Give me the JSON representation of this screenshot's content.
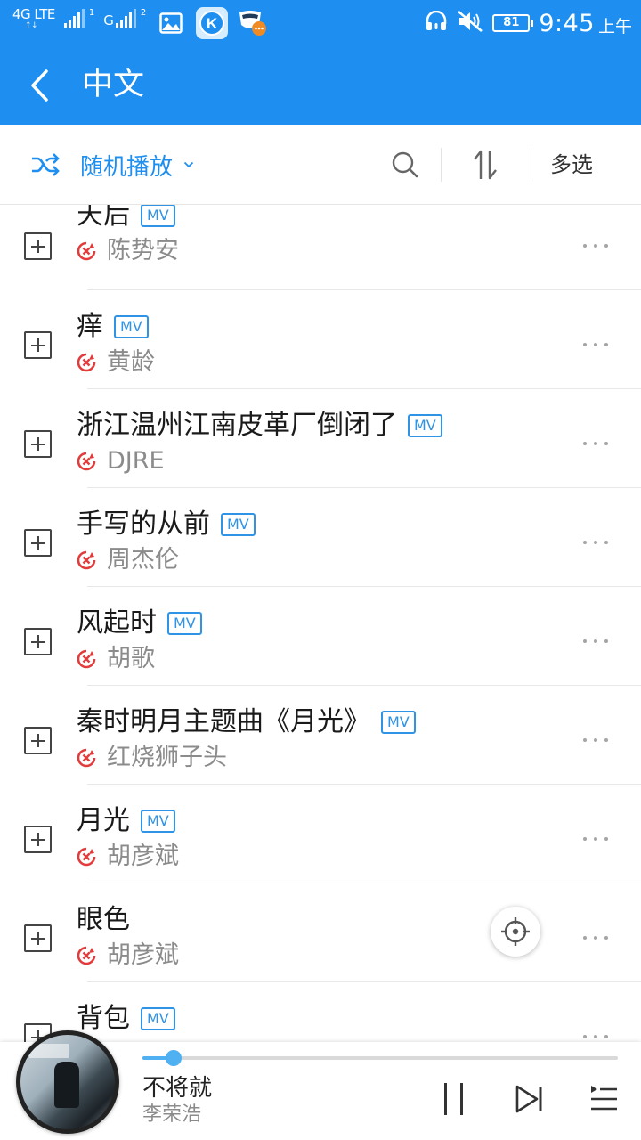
{
  "status_bar": {
    "network": "4G LTE",
    "network_sub": "↑↓",
    "sim1_index": "1",
    "sim2_label": "G",
    "sim2_index": "2",
    "battery": "81",
    "time": "9:45",
    "ampm": "上午",
    "icons": [
      "image-icon",
      "kugou-app-icon",
      "message-app-icon",
      "headset-icon",
      "mute-icon"
    ]
  },
  "header": {
    "title": "中文",
    "background": "#1e8ff0"
  },
  "toolbar": {
    "shuffle_label": "随机播放",
    "multi_select_label": "多选",
    "accent": "#1e8ff0"
  },
  "songs": [
    {
      "title": "天后",
      "artist": "陈势安",
      "mv": "MV"
    },
    {
      "title": "痒",
      "artist": "黄龄",
      "mv": "MV"
    },
    {
      "title": "浙江温州江南皮革厂倒闭了",
      "artist": "DJRE",
      "mv": "MV"
    },
    {
      "title": "手写的从前",
      "artist": "周杰伦",
      "mv": "MV"
    },
    {
      "title": "风起时",
      "artist": "胡歌",
      "mv": "MV"
    },
    {
      "title": "秦时明月主题曲《月光》",
      "artist": "红烧狮子头",
      "mv": "MV"
    },
    {
      "title": "月光",
      "artist": "胡彦斌",
      "mv": "MV"
    },
    {
      "title": "眼色",
      "artist": "胡彦斌",
      "mv": ""
    },
    {
      "title": "背包",
      "artist": "",
      "mv": "MV"
    }
  ],
  "player": {
    "title": "不将就",
    "artist": "李荣浩",
    "progress": 0.065
  }
}
